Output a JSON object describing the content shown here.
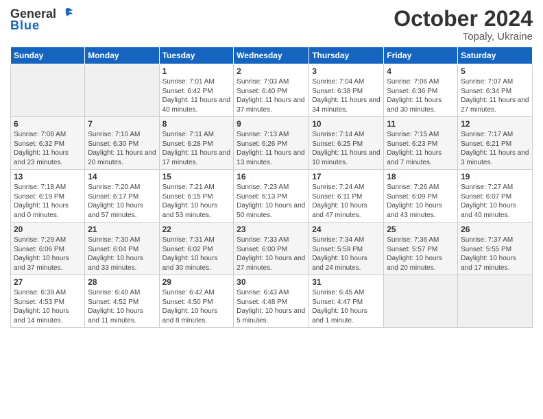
{
  "logo": {
    "general": "General",
    "blue": "Blue"
  },
  "header": {
    "month": "October 2024",
    "location": "Topaly, Ukraine"
  },
  "weekdays": [
    "Sunday",
    "Monday",
    "Tuesday",
    "Wednesday",
    "Thursday",
    "Friday",
    "Saturday"
  ],
  "weeks": [
    [
      {
        "day": "",
        "info": ""
      },
      {
        "day": "",
        "info": ""
      },
      {
        "day": "1",
        "info": "Sunrise: 7:01 AM\nSunset: 6:42 PM\nDaylight: 11 hours and 40 minutes."
      },
      {
        "day": "2",
        "info": "Sunrise: 7:03 AM\nSunset: 6:40 PM\nDaylight: 11 hours and 37 minutes."
      },
      {
        "day": "3",
        "info": "Sunrise: 7:04 AM\nSunset: 6:38 PM\nDaylight: 11 hours and 34 minutes."
      },
      {
        "day": "4",
        "info": "Sunrise: 7:06 AM\nSunset: 6:36 PM\nDaylight: 11 hours and 30 minutes."
      },
      {
        "day": "5",
        "info": "Sunrise: 7:07 AM\nSunset: 6:34 PM\nDaylight: 11 hours and 27 minutes."
      }
    ],
    [
      {
        "day": "6",
        "info": "Sunrise: 7:08 AM\nSunset: 6:32 PM\nDaylight: 11 hours and 23 minutes."
      },
      {
        "day": "7",
        "info": "Sunrise: 7:10 AM\nSunset: 6:30 PM\nDaylight: 11 hours and 20 minutes."
      },
      {
        "day": "8",
        "info": "Sunrise: 7:11 AM\nSunset: 6:28 PM\nDaylight: 11 hours and 17 minutes."
      },
      {
        "day": "9",
        "info": "Sunrise: 7:13 AM\nSunset: 6:26 PM\nDaylight: 11 hours and 13 minutes."
      },
      {
        "day": "10",
        "info": "Sunrise: 7:14 AM\nSunset: 6:25 PM\nDaylight: 11 hours and 10 minutes."
      },
      {
        "day": "11",
        "info": "Sunrise: 7:15 AM\nSunset: 6:23 PM\nDaylight: 11 hours and 7 minutes."
      },
      {
        "day": "12",
        "info": "Sunrise: 7:17 AM\nSunset: 6:21 PM\nDaylight: 11 hours and 3 minutes."
      }
    ],
    [
      {
        "day": "13",
        "info": "Sunrise: 7:18 AM\nSunset: 6:19 PM\nDaylight: 11 hours and 0 minutes."
      },
      {
        "day": "14",
        "info": "Sunrise: 7:20 AM\nSunset: 6:17 PM\nDaylight: 10 hours and 57 minutes."
      },
      {
        "day": "15",
        "info": "Sunrise: 7:21 AM\nSunset: 6:15 PM\nDaylight: 10 hours and 53 minutes."
      },
      {
        "day": "16",
        "info": "Sunrise: 7:23 AM\nSunset: 6:13 PM\nDaylight: 10 hours and 50 minutes."
      },
      {
        "day": "17",
        "info": "Sunrise: 7:24 AM\nSunset: 6:11 PM\nDaylight: 10 hours and 47 minutes."
      },
      {
        "day": "18",
        "info": "Sunrise: 7:26 AM\nSunset: 6:09 PM\nDaylight: 10 hours and 43 minutes."
      },
      {
        "day": "19",
        "info": "Sunrise: 7:27 AM\nSunset: 6:07 PM\nDaylight: 10 hours and 40 minutes."
      }
    ],
    [
      {
        "day": "20",
        "info": "Sunrise: 7:29 AM\nSunset: 6:06 PM\nDaylight: 10 hours and 37 minutes."
      },
      {
        "day": "21",
        "info": "Sunrise: 7:30 AM\nSunset: 6:04 PM\nDaylight: 10 hours and 33 minutes."
      },
      {
        "day": "22",
        "info": "Sunrise: 7:31 AM\nSunset: 6:02 PM\nDaylight: 10 hours and 30 minutes."
      },
      {
        "day": "23",
        "info": "Sunrise: 7:33 AM\nSunset: 6:00 PM\nDaylight: 10 hours and 27 minutes."
      },
      {
        "day": "24",
        "info": "Sunrise: 7:34 AM\nSunset: 5:59 PM\nDaylight: 10 hours and 24 minutes."
      },
      {
        "day": "25",
        "info": "Sunrise: 7:36 AM\nSunset: 5:57 PM\nDaylight: 10 hours and 20 minutes."
      },
      {
        "day": "26",
        "info": "Sunrise: 7:37 AM\nSunset: 5:55 PM\nDaylight: 10 hours and 17 minutes."
      }
    ],
    [
      {
        "day": "27",
        "info": "Sunrise: 6:39 AM\nSunset: 4:53 PM\nDaylight: 10 hours and 14 minutes."
      },
      {
        "day": "28",
        "info": "Sunrise: 6:40 AM\nSunset: 4:52 PM\nDaylight: 10 hours and 11 minutes."
      },
      {
        "day": "29",
        "info": "Sunrise: 6:42 AM\nSunset: 4:50 PM\nDaylight: 10 hours and 8 minutes."
      },
      {
        "day": "30",
        "info": "Sunrise: 6:43 AM\nSunset: 4:48 PM\nDaylight: 10 hours and 5 minutes."
      },
      {
        "day": "31",
        "info": "Sunrise: 6:45 AM\nSunset: 4:47 PM\nDaylight: 10 hours and 1 minute."
      },
      {
        "day": "",
        "info": ""
      },
      {
        "day": "",
        "info": ""
      }
    ]
  ]
}
